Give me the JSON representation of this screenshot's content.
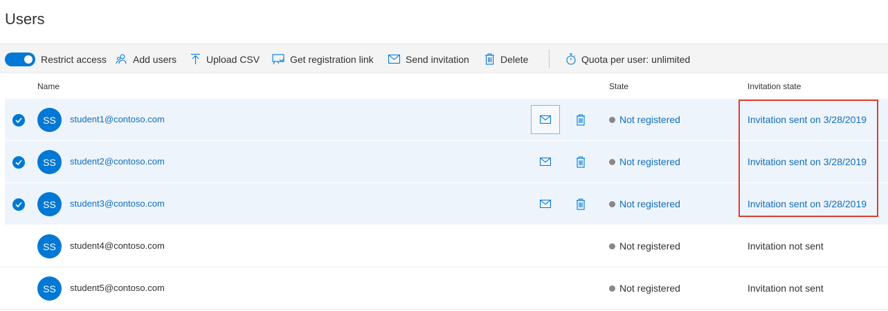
{
  "page": {
    "title": "Users"
  },
  "toolbar": {
    "restrict_access": "Restrict access",
    "add_users": "Add users",
    "upload_csv": "Upload CSV",
    "get_registration_link": "Get registration link",
    "send_invitation": "Send invitation",
    "delete": "Delete",
    "quota": "Quota per user: unlimited"
  },
  "table": {
    "columns": {
      "name": "Name",
      "state": "State",
      "invitation_state": "Invitation state"
    },
    "rows": [
      {
        "initials": "SS",
        "email": "student1@contoso.com",
        "state": "Not registered",
        "invitation": "Invitation sent on 3/28/2019",
        "selected": true
      },
      {
        "initials": "SS",
        "email": "student2@contoso.com",
        "state": "Not registered",
        "invitation": "Invitation sent on 3/28/2019",
        "selected": true
      },
      {
        "initials": "SS",
        "email": "student3@contoso.com",
        "state": "Not registered",
        "invitation": "Invitation sent on 3/28/2019",
        "selected": true
      },
      {
        "initials": "SS",
        "email": "student4@contoso.com",
        "state": "Not registered",
        "invitation": "Invitation not sent",
        "selected": false
      },
      {
        "initials": "SS",
        "email": "student5@contoso.com",
        "state": "Not registered",
        "invitation": "Invitation not sent",
        "selected": false
      }
    ]
  },
  "colors": {
    "accent": "#0078d4",
    "link": "#106ebe",
    "selected_row": "#eef4fb",
    "highlight": "#e03c31",
    "status_dot": "#8a8886"
  }
}
